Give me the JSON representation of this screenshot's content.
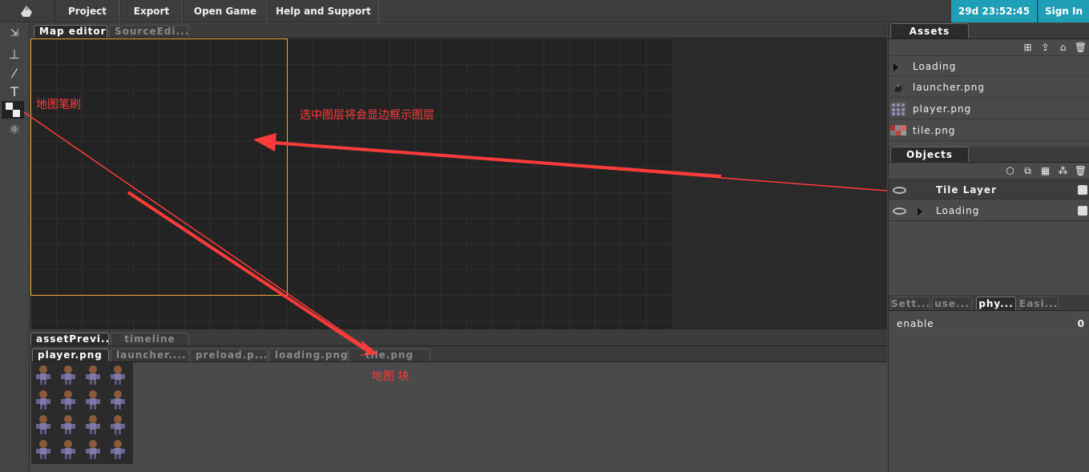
{
  "menu": {
    "items": [
      "Project",
      "Export",
      "Open Game",
      "Help and Support"
    ],
    "clock": "29d 23:52:45",
    "sign_in": "Sign In"
  },
  "editor_tabs": [
    "Map editor",
    "SourceEdi..."
  ],
  "bottom_tabs": [
    "assetPrevi...",
    "timeline"
  ],
  "preview_tabs": [
    "player.png",
    "launcher....",
    "preload.p...",
    "loading.png",
    "tile.png"
  ],
  "assets": {
    "title": "Assets",
    "items": [
      {
        "label": "Loading",
        "type": "folder"
      },
      {
        "label": "launcher.png",
        "type": "image"
      },
      {
        "label": "player.png",
        "type": "image"
      },
      {
        "label": "tile.png",
        "type": "image"
      }
    ]
  },
  "objects": {
    "title": "Objects",
    "items": [
      {
        "label": "Tile Layer"
      },
      {
        "label": "Loading"
      }
    ]
  },
  "settings_tabs": [
    "Sett...",
    "use...",
    "phy...",
    "Easi..."
  ],
  "properties": [
    {
      "name": "enable",
      "value": "0"
    }
  ],
  "annotations": {
    "brush": "地图笔刷",
    "layer": "选中图层将会显边框示图层",
    "tile": "地图 块"
  },
  "colors": {
    "accent": "#1e9fb6",
    "annotation": "#ff3b3b",
    "layer_border": "#e8a93a"
  }
}
